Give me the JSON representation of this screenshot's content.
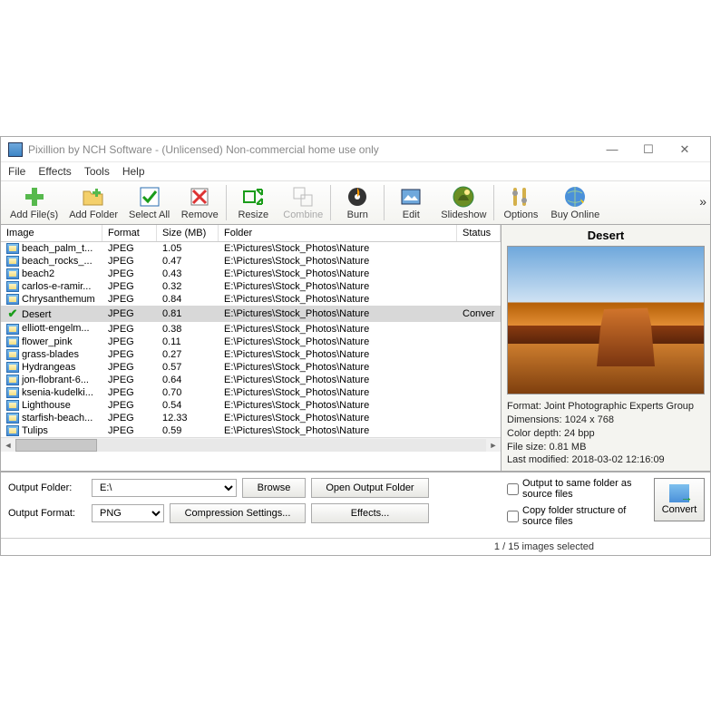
{
  "window": {
    "title": "Pixillion by NCH Software - (Unlicensed) Non-commercial home use only"
  },
  "menubar": [
    "File",
    "Effects",
    "Tools",
    "Help"
  ],
  "toolbar": [
    {
      "label": "Add File(s)",
      "icon": "plus"
    },
    {
      "label": "Add Folder",
      "icon": "folder-plus"
    },
    {
      "label": "Select All",
      "icon": "select-all"
    },
    {
      "label": "Remove",
      "icon": "remove"
    },
    {
      "sep": true
    },
    {
      "label": "Resize",
      "icon": "resize"
    },
    {
      "label": "Combine",
      "icon": "combine",
      "disabled": true
    },
    {
      "sep": true
    },
    {
      "label": "Burn",
      "icon": "burn"
    },
    {
      "sep": true
    },
    {
      "label": "Edit",
      "icon": "edit"
    },
    {
      "label": "Slideshow",
      "icon": "slideshow"
    },
    {
      "sep": true
    },
    {
      "label": "Options",
      "icon": "options"
    },
    {
      "label": "Buy Online",
      "icon": "buy"
    }
  ],
  "columns": {
    "image": "Image",
    "format": "Format",
    "size": "Size (MB)",
    "folder": "Folder",
    "status": "Status"
  },
  "rows": [
    {
      "name": "beach_palm_t...",
      "fmt": "JPEG",
      "size": "1.05",
      "folder": "E:\\Pictures\\Stock_Photos\\Nature"
    },
    {
      "name": "beach_rocks_...",
      "fmt": "JPEG",
      "size": "0.47",
      "folder": "E:\\Pictures\\Stock_Photos\\Nature"
    },
    {
      "name": "beach2",
      "fmt": "JPEG",
      "size": "0.43",
      "folder": "E:\\Pictures\\Stock_Photos\\Nature"
    },
    {
      "name": "carlos-e-ramir...",
      "fmt": "JPEG",
      "size": "0.32",
      "folder": "E:\\Pictures\\Stock_Photos\\Nature"
    },
    {
      "name": "Chrysanthemum",
      "fmt": "JPEG",
      "size": "0.84",
      "folder": "E:\\Pictures\\Stock_Photos\\Nature"
    },
    {
      "name": "Desert",
      "fmt": "JPEG",
      "size": "0.81",
      "folder": "E:\\Pictures\\Stock_Photos\\Nature",
      "selected": true,
      "status": "Conver"
    },
    {
      "name": "elliott-engelm...",
      "fmt": "JPEG",
      "size": "0.38",
      "folder": "E:\\Pictures\\Stock_Photos\\Nature"
    },
    {
      "name": "flower_pink",
      "fmt": "JPEG",
      "size": "0.11",
      "folder": "E:\\Pictures\\Stock_Photos\\Nature"
    },
    {
      "name": "grass-blades",
      "fmt": "JPEG",
      "size": "0.27",
      "folder": "E:\\Pictures\\Stock_Photos\\Nature"
    },
    {
      "name": "Hydrangeas",
      "fmt": "JPEG",
      "size": "0.57",
      "folder": "E:\\Pictures\\Stock_Photos\\Nature"
    },
    {
      "name": "jon-flobrant-6...",
      "fmt": "JPEG",
      "size": "0.64",
      "folder": "E:\\Pictures\\Stock_Photos\\Nature"
    },
    {
      "name": "ksenia-kudelki...",
      "fmt": "JPEG",
      "size": "0.70",
      "folder": "E:\\Pictures\\Stock_Photos\\Nature"
    },
    {
      "name": "Lighthouse",
      "fmt": "JPEG",
      "size": "0.54",
      "folder": "E:\\Pictures\\Stock_Photos\\Nature"
    },
    {
      "name": "starfish-beach...",
      "fmt": "JPEG",
      "size": "12.33",
      "folder": "E:\\Pictures\\Stock_Photos\\Nature"
    },
    {
      "name": "Tulips",
      "fmt": "JPEG",
      "size": "0.59",
      "folder": "E:\\Pictures\\Stock_Photos\\Nature"
    }
  ],
  "preview": {
    "title": "Desert",
    "info": {
      "format": "Format: Joint Photographic Experts Group",
      "dimensions": "Dimensions: 1024 x 768",
      "depth": "Color depth: 24 bpp",
      "filesize": "File size: 0.81 MB",
      "modified": "Last modified: 2018-03-02 12:16:09"
    }
  },
  "output": {
    "folder_label": "Output Folder:",
    "folder_value": "E:\\",
    "browse": "Browse",
    "open": "Open Output Folder",
    "format_label": "Output Format:",
    "format_value": "PNG",
    "compression": "Compression Settings...",
    "effects": "Effects..."
  },
  "options": {
    "same_folder": "Output to same folder as source files",
    "copy_structure": "Copy folder structure of source files"
  },
  "convert_label": "Convert",
  "statusbar": "1 / 15 images selected"
}
